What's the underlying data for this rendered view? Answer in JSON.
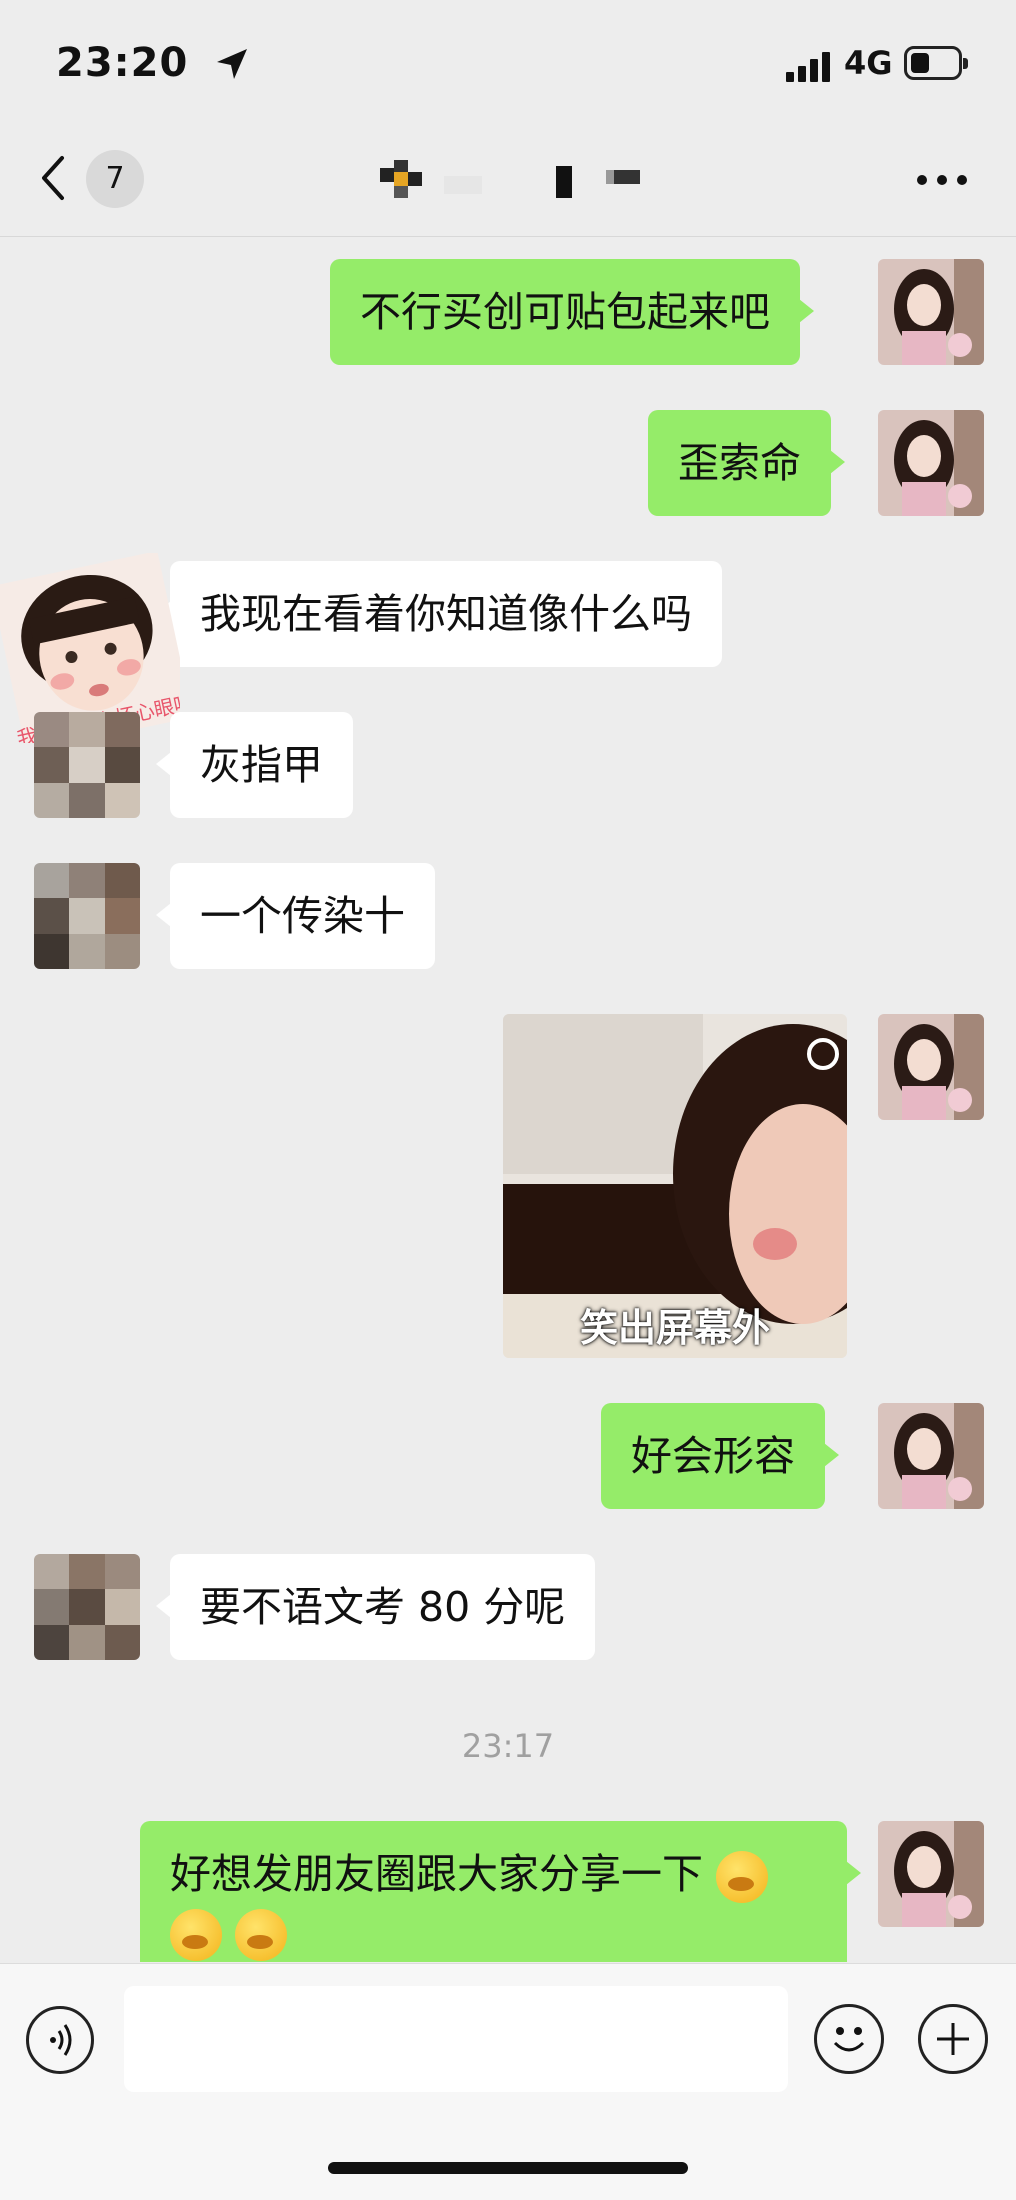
{
  "status_bar": {
    "time": "23:20",
    "network": "4G",
    "battery_level": 0.35,
    "icons": [
      "location-arrow-icon",
      "signal-icon",
      "battery-icon"
    ]
  },
  "nav": {
    "back_icon": "chevron-left-icon",
    "unread_count": "7",
    "title": "",
    "more_icon": "more-dots-icon"
  },
  "messages": [
    {
      "side": "right",
      "type": "text",
      "text": "不行买创可贴包起来吧"
    },
    {
      "side": "right",
      "type": "text",
      "text": "歪索命"
    },
    {
      "side": "left",
      "type": "text",
      "text": "我现在看着你知道像什么吗",
      "sticker_text": "我能有什么坏心眼呢"
    },
    {
      "side": "left",
      "type": "text",
      "text": "灰指甲"
    },
    {
      "side": "left",
      "type": "text",
      "text": "一个传染十"
    },
    {
      "side": "right",
      "type": "image",
      "caption": "笑出屏幕外"
    },
    {
      "side": "right",
      "type": "text",
      "text": "好会形容"
    },
    {
      "side": "left",
      "type": "text",
      "text": "要不语文考 80 分呢"
    },
    {
      "side": "center",
      "type": "timestamp",
      "text": "23:17"
    },
    {
      "side": "right",
      "type": "text",
      "text": "好想发朋友圈跟大家分享一下"
    }
  ],
  "input_bar": {
    "voice_icon": "voice-icon",
    "placeholder": "",
    "emoji_icon": "emoji-icon",
    "plus_icon": "plus-icon"
  },
  "colors": {
    "background": "#ededed",
    "right_bubble": "#95ec69",
    "left_bubble": "#ffffff",
    "timestamp": "#a0a0a0"
  }
}
